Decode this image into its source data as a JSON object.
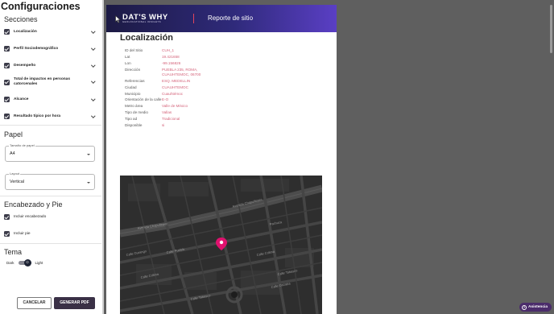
{
  "settings": {
    "title": "Configuraciones",
    "sections_title": "Secciones",
    "sections": [
      {
        "label": "Localización",
        "checked": true
      },
      {
        "label": "Perfil Sociodemográfico",
        "checked": true
      },
      {
        "label": "Desempeño",
        "checked": true
      },
      {
        "label": "Total de impactos en personas catorcenales",
        "checked": true
      },
      {
        "label": "Alcance",
        "checked": true
      },
      {
        "label": "Resultado típico por hora",
        "checked": true
      }
    ],
    "paper_title": "Papel",
    "paper_size": {
      "label": "Tamaño de papel",
      "value": "A4"
    },
    "layout": {
      "label": "Layout",
      "value": "Vertical"
    },
    "header_footer_title": "Encabezado y Pie",
    "include_header": {
      "label": "Incluir encabezado",
      "checked": true
    },
    "include_footer": {
      "label": "Incluir pie",
      "checked": true
    },
    "theme_title": "Tema",
    "theme": {
      "dark_label": "Dark",
      "light_label": "Light",
      "selected": "Light",
      "icon": "sun-icon"
    },
    "cancel_label": "CANCELAR",
    "generate_label": "GENERAR PDF"
  },
  "report": {
    "logo_text": "DAT'S WHY",
    "logo_sub": "GEOLOCATIONAL INSIGHTS",
    "title": "Reporte de sitio",
    "section_title": "Localización",
    "fields": [
      {
        "key": "ID del Sitio",
        "value": "CUH_1"
      },
      {
        "key": "Lat",
        "value": "19.421658"
      },
      {
        "key": "Lon",
        "value": "-99.156826"
      },
      {
        "key": "Dirección",
        "value": "PUEBLA 235, ROMA, CUAUHTEMOC, 06700"
      },
      {
        "key": "Referencias",
        "value": "ESQ. MEDELLIN"
      },
      {
        "key": "Ciudad",
        "value": "CUAUHTEMOC"
      },
      {
        "key": "Municipio",
        "value": "Cuauhtémoc"
      },
      {
        "key": "Orientación de la calle",
        "value": "E-O"
      },
      {
        "key": "Metro área",
        "value": "Valle de México"
      },
      {
        "key": "Tipo de medio",
        "value": "Vallas"
      },
      {
        "key": "Tipo ad",
        "value": "Tradicional"
      },
      {
        "key": "Disponible",
        "value": "si"
      }
    ],
    "map_streets": [
      "Avenida Chapultepec",
      "Avenida Chapultepec",
      "Calle Puebla",
      "Calle Durango",
      "Calle Colima",
      "Calle Colima",
      "Calle Tabasco",
      "Calle Tabasco",
      "Pachuca",
      "Calle Orizaba"
    ]
  },
  "assist_label": "Asistencia",
  "colors": {
    "accent": "#3a3046",
    "link": "#d4637a",
    "header_start": "#1c1a44",
    "header_end": "#5a3fc4",
    "pin": "#e0116e"
  }
}
